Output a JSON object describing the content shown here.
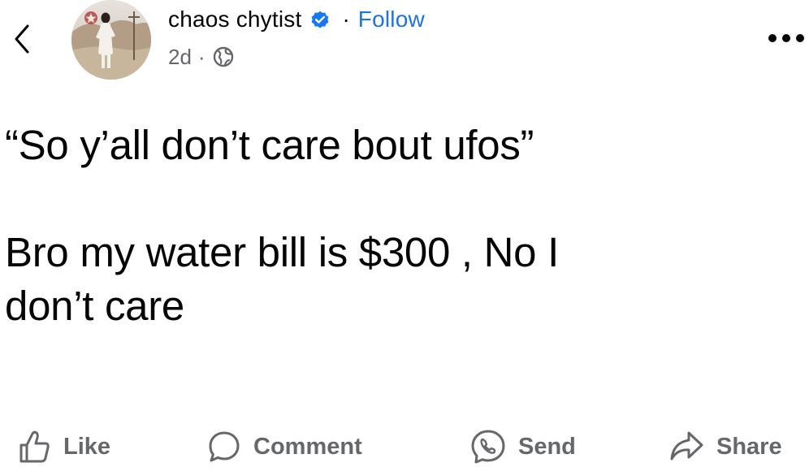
{
  "header": {
    "back_icon": "chevron-left-icon",
    "author_name": "chaos chytist",
    "verified_icon": "verified-badge-icon",
    "separator": "·",
    "follow_label": "Follow",
    "time": "2d",
    "meta_separator": "·",
    "privacy_icon": "globe-icon",
    "more_icon": "more-horizontal-icon"
  },
  "post": {
    "line1": "“So y’all don’t care bout ufos”",
    "line2": "Bro my water bill is $300 , No I",
    "line3": "don’t care"
  },
  "actions": [
    {
      "label": "Like",
      "icon": "thumbs-up-icon"
    },
    {
      "label": "Comment",
      "icon": "comment-bubble-icon"
    },
    {
      "label": "Send",
      "icon": "messenger-icon"
    },
    {
      "label": "Share",
      "icon": "share-arrow-icon"
    }
  ],
  "colors": {
    "accent": "#1b74e4",
    "secondary_text": "#65676b",
    "primary_text": "#050505",
    "verified": "#1877f2"
  }
}
